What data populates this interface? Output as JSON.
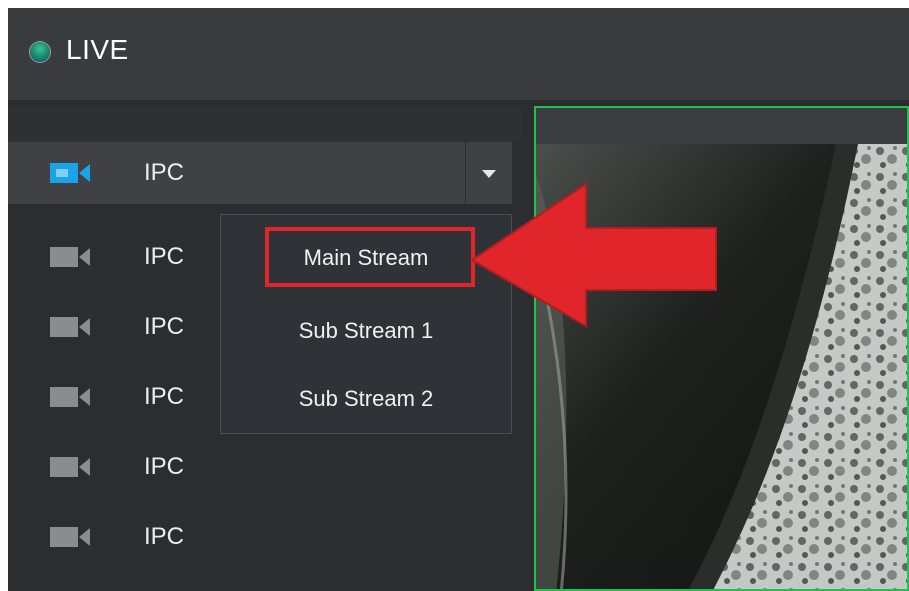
{
  "header": {
    "title": "LIVE",
    "status_icon": "live-status-icon"
  },
  "channels": [
    {
      "label": "IPC",
      "icon": "camera-icon",
      "selected": true
    },
    {
      "label": "IPC",
      "icon": "camera-icon",
      "selected": false
    },
    {
      "label": "IPC",
      "icon": "camera-icon",
      "selected": false
    },
    {
      "label": "IPC",
      "icon": "camera-icon",
      "selected": false
    },
    {
      "label": "IPC",
      "icon": "camera-icon",
      "selected": false
    },
    {
      "label": "IPC",
      "icon": "camera-icon",
      "selected": false
    }
  ],
  "stream_menu": {
    "items": [
      "Main Stream",
      "Sub Stream 1",
      "Sub Stream 2"
    ],
    "highlighted": "Main Stream"
  },
  "colors": {
    "accent_selected_camera": "#1aa3e8",
    "camera_icon": "#8a8c8f",
    "video_border": "#22c04c",
    "annotation_red": "#e0262a"
  }
}
